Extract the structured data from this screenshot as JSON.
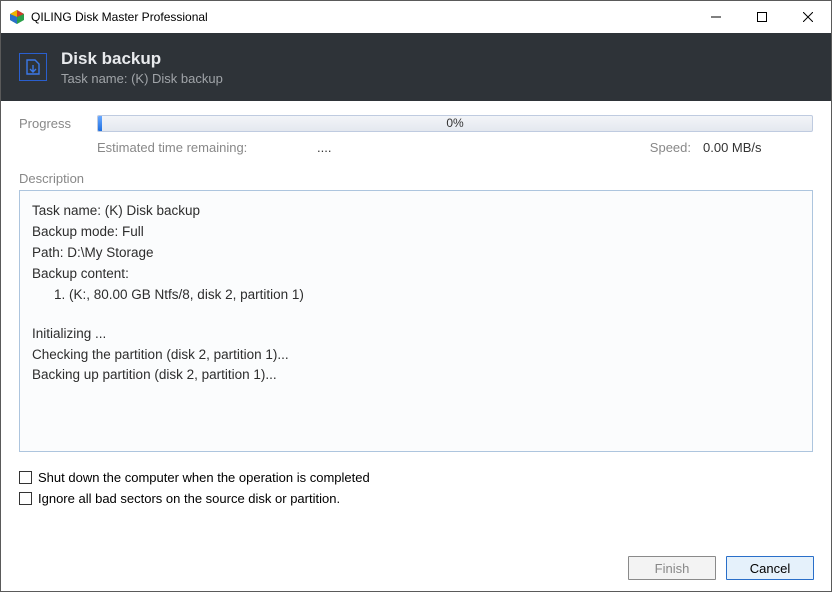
{
  "window": {
    "title": "QILING Disk Master Professional"
  },
  "header": {
    "title": "Disk backup",
    "subtitle": "Task name: (K) Disk backup"
  },
  "progress": {
    "label": "Progress",
    "percent_text": "0%",
    "etr_label": "Estimated time remaining:",
    "etr_value": "....",
    "speed_label": "Speed:",
    "speed_value": "0.00 MB/s"
  },
  "description": {
    "label": "Description",
    "lines": {
      "task": "Task name: (K) Disk backup",
      "mode": "Backup mode: Full",
      "path": "Path: D:\\My Storage",
      "content_hdr": "Backup content:",
      "content_1": "1. (K:, 80.00 GB Ntfs/8, disk 2, partition 1)",
      "init": "Initializing ...",
      "check": "Checking the partition (disk 2, partition 1)...",
      "backing": "Backing up partition (disk 2, partition 1)..."
    }
  },
  "checks": {
    "shutdown": "Shut down the computer when the operation is completed",
    "ignore": "Ignore all bad sectors on the source disk or partition."
  },
  "buttons": {
    "finish": "Finish",
    "cancel": "Cancel"
  }
}
